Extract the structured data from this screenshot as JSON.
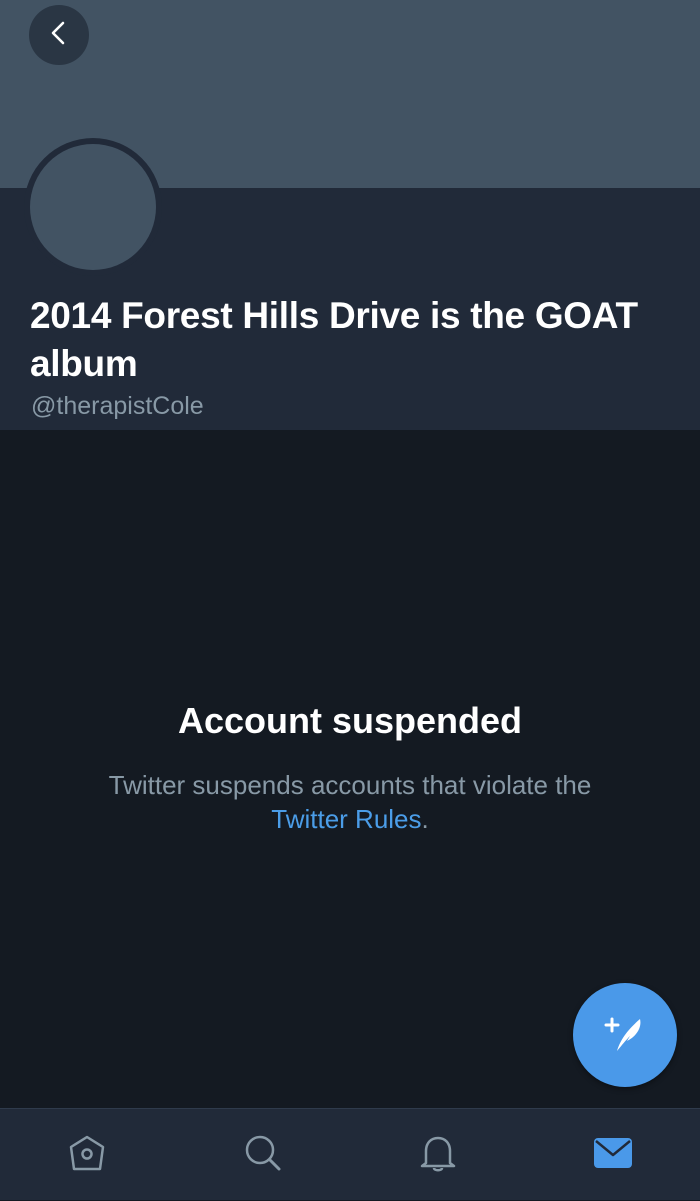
{
  "header": {
    "back_icon": "chevron-left-icon"
  },
  "profile": {
    "display_name": "2014 Forest Hills Drive is the GOAT album",
    "handle": "@therapistCole"
  },
  "notice": {
    "title": "Account suspended",
    "description": "Twitter suspends accounts that violate the",
    "link_text": "Twitter Rules",
    "trailing": "."
  },
  "compose": {
    "icon": "compose-tweet-icon"
  },
  "tab_bar": {
    "tabs": [
      {
        "icon": "home-icon",
        "active": false
      },
      {
        "icon": "search-icon",
        "active": false
      },
      {
        "icon": "notifications-icon",
        "active": false
      },
      {
        "icon": "messages-icon",
        "active": true
      }
    ]
  },
  "colors": {
    "background": "#141a22",
    "header_panel": "#212a39",
    "banner": "#425363",
    "accent": "#4a99e9",
    "muted_text": "#8899a6"
  }
}
